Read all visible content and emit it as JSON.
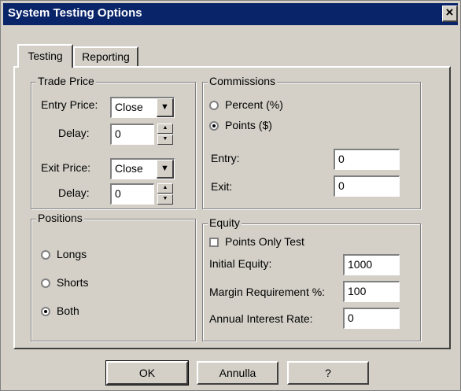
{
  "window": {
    "title": "System Testing Options",
    "close_glyph": "×"
  },
  "tabs": [
    {
      "label": "Testing",
      "active": true
    },
    {
      "label": "Reporting",
      "active": false
    }
  ],
  "trade_price": {
    "title": "Trade Price",
    "entry_price_label": "Entry Price:",
    "entry_price_value": "Close",
    "entry_delay_label": "Delay:",
    "entry_delay_value": "0",
    "exit_price_label": "Exit Price:",
    "exit_price_value": "Close",
    "exit_delay_label": "Delay:",
    "exit_delay_value": "0"
  },
  "commissions": {
    "title": "Commissions",
    "percent_label": "Percent (%)",
    "points_label": "Points ($)",
    "selected": "points",
    "entry_label": "Entry:",
    "entry_value": "0",
    "exit_label": "Exit:",
    "exit_value": "0"
  },
  "positions": {
    "title": "Positions",
    "longs_label": "Longs",
    "shorts_label": "Shorts",
    "both_label": "Both",
    "selected": "both"
  },
  "equity": {
    "title": "Equity",
    "points_only_label": "Points Only Test",
    "points_only_checked": false,
    "initial_equity_label": "Initial Equity:",
    "initial_equity_value": "1000",
    "margin_label": "Margin Requirement %:",
    "margin_value": "100",
    "interest_label": "Annual Interest Rate:",
    "interest_value": "0"
  },
  "buttons": {
    "ok": "OK",
    "cancel": "Annulla",
    "help": "?"
  }
}
